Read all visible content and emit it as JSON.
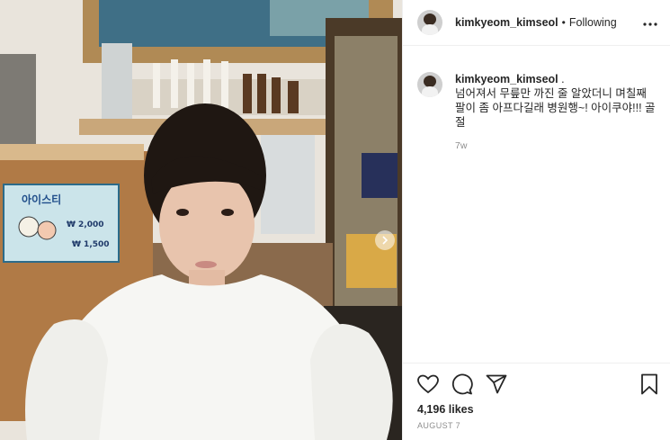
{
  "header": {
    "username": "kimkyeom_kimseol",
    "dot": "•",
    "follow_status": "Following",
    "more_icon": "more-horizontal-icon"
  },
  "post": {
    "username": "kimkyeom_kimseol",
    "caption": " .\n넘어져서 무릎만 까진 줄 알았더니 며칠째 팔이 좀 아프다길래 병원행~! 아이쿠야!!! 골절",
    "time": "7w"
  },
  "photo": {
    "sign_title": "아이스티",
    "sign_price_1": "₩ 2,000",
    "sign_price_2": "₩ 1,500",
    "carousel_icon": "chevron-right-icon"
  },
  "actions": {
    "like_icon": "heart-icon",
    "comment_icon": "comment-icon",
    "share_icon": "paper-plane-icon",
    "save_icon": "bookmark-icon",
    "likes": "4,196 likes",
    "date": "AUGUST 7"
  },
  "colors": {
    "text": "#262626",
    "muted": "#8e8e8e",
    "border": "#efefef"
  }
}
